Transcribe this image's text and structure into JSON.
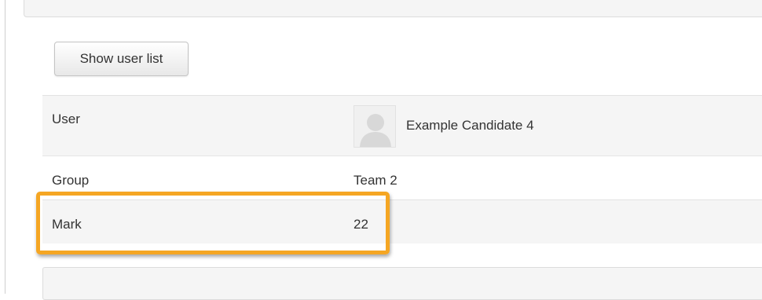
{
  "toolbar": {
    "show_user_list_label": "Show user list"
  },
  "details": {
    "user": {
      "label": "User",
      "name": "Example Candidate 4",
      "avatar_icon": "user-silhouette-icon"
    },
    "group": {
      "label": "Group",
      "value": "Team 2"
    },
    "mark": {
      "label": "Mark",
      "value": "22"
    }
  },
  "colors": {
    "highlight": "#f5a623",
    "row_shaded": "#f5f5f5"
  }
}
